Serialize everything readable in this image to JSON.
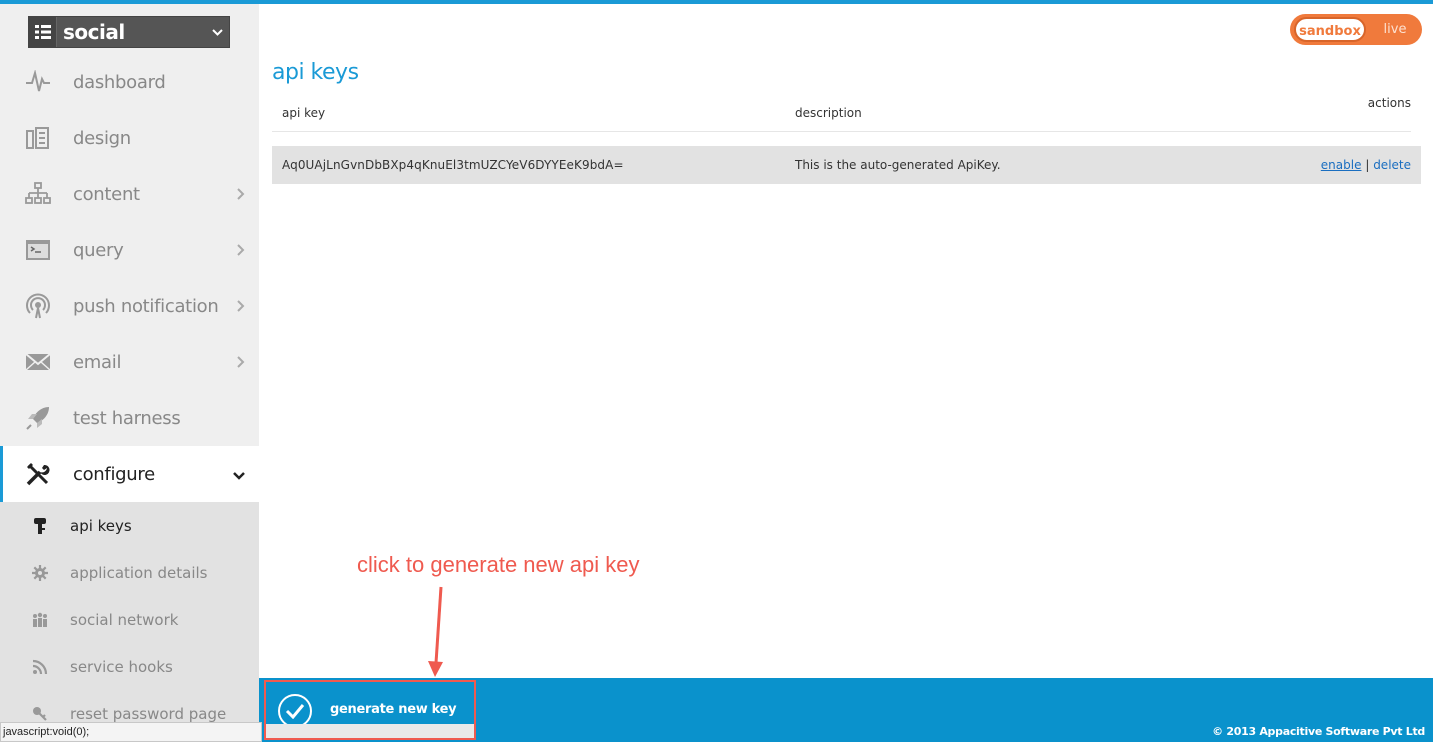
{
  "app_selector": {
    "name": "social"
  },
  "nav": {
    "items": [
      {
        "label": "dashboard",
        "icon": "pulse-icon",
        "chevron": false
      },
      {
        "label": "design",
        "icon": "design-icon",
        "chevron": false
      },
      {
        "label": "content",
        "icon": "hierarchy-icon",
        "chevron": true
      },
      {
        "label": "query",
        "icon": "terminal-icon",
        "chevron": true
      },
      {
        "label": "push notification",
        "icon": "broadcast-icon",
        "chevron": true
      },
      {
        "label": "email",
        "icon": "envelope-icon",
        "chevron": true
      },
      {
        "label": "test harness",
        "icon": "rocket-icon",
        "chevron": false
      },
      {
        "label": "configure",
        "icon": "tools-icon",
        "chevron": true,
        "active": true
      }
    ],
    "sub_items": [
      {
        "label": "api keys",
        "icon": "key-icon",
        "active": true
      },
      {
        "label": "application details",
        "icon": "gear-icon"
      },
      {
        "label": "social network",
        "icon": "people-icon"
      },
      {
        "label": "service hooks",
        "icon": "rss-icon"
      },
      {
        "label": "reset password page",
        "icon": "key-icon"
      }
    ]
  },
  "env_toggle": {
    "selected": "sandbox",
    "other": "live"
  },
  "page": {
    "title": "api keys"
  },
  "table": {
    "headers": {
      "api_key": "api key",
      "description": "description",
      "actions": "actions"
    },
    "rows": [
      {
        "api_key": "Aq0UAjLnGvnDbBXp4qKnuEl3tmUZCYeV6DYYEeK9bdA=",
        "description": "This is the auto-generated ApiKey.",
        "action_enable": "enable",
        "action_separator": "|",
        "action_delete": "delete"
      }
    ]
  },
  "annotation": {
    "text": "click to generate new api key"
  },
  "footer": {
    "generate_button": "generate new key",
    "copyright": "© 2013 Appacitive Software Pvt Ltd"
  },
  "status_bar": {
    "text": "javascript:void(0);"
  },
  "colors": {
    "accent": "#1a9ad6",
    "footer": "#0a92cc",
    "toggle": "#f07a3c",
    "annotation": "#ef5a4f"
  }
}
